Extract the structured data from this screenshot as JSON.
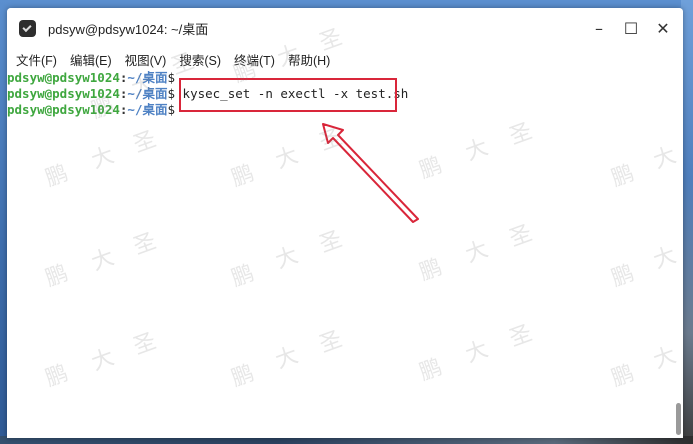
{
  "window": {
    "title": "pdsyw@pdsyw1024: ~/桌面",
    "controls": {
      "minimize": "–",
      "maximize": "☐",
      "close": "✕"
    }
  },
  "menu": [
    {
      "label": "文件(F)"
    },
    {
      "label": "编辑(E)"
    },
    {
      "label": "视图(V)"
    },
    {
      "label": "搜索(S)"
    },
    {
      "label": "终端(T)"
    },
    {
      "label": "帮助(H)"
    }
  ],
  "terminal": {
    "lines": [
      {
        "user": "pdsyw@pdsyw1024",
        "sep": ":",
        "path": "~/桌面",
        "dollar": "$",
        "command": ""
      },
      {
        "user": "pdsyw@pdsyw1024",
        "sep": ":",
        "path": "~/桌面",
        "dollar": "$",
        "command": " kysec_set -n exectl -x test.sh"
      },
      {
        "user": "pdsyw@pdsyw1024",
        "sep": ":",
        "path": "~/桌面",
        "dollar": "$",
        "command": ""
      }
    ]
  },
  "watermark": {
    "chars": [
      "鹏",
      "大",
      "圣"
    ]
  },
  "colors": {
    "prompt_user": "#3fa73f",
    "prompt_path": "#4f82c4",
    "annotation": "#d9263a"
  }
}
